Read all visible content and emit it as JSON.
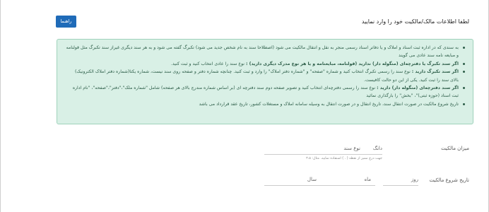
{
  "header": {
    "title": "لطفا اطلاعات مالک/مالکیت خود را وارد نمایید",
    "guide_button": "راهنما"
  },
  "info": {
    "item1": "به سندی که در اداره ثبت اسناد و املاک و یا دفاتر اسناد رسمی منجر به نقل و انتقال مالکیت می شود (اصطلاحا سند به نام شخص جدید می شود) تکبرگ گفته می شود و به هر سند دیگری غیراز سند تکبرگ مثل قولنامه و مبایعه نامه سند عادی می گویند",
    "item2_bold": "اگر سند تکبرگ یا دفترچه‌ای (منگوله دار) ندارید (قولنامه، مبایعنامه و یا هر نوع مدرک دیگری دارید) :",
    "item2_rest": "نوع سند را عادی انتخاب کنید و ثبت کنید.",
    "item3_bold": "اگر سند تکبرگ دارید :",
    "item3_rest": "نوع سند را رسمی تکبرگ انتخاب کنید و شماره \"صفحه\" و \"شماره دفتر املاک\" را وارد و ثبت کنید. چنانچه شماره دفتر و صفحه روی سند نیست، شماره یکتا(شماره دفتر املاک الکترونیک) بالای سند را ثبت کنید. یکی از این دو حالت کافیست.",
    "item4_bold": "اگر سند دفترچه‌ای (منگوله دار) دارید :",
    "item4_rest": "نوع سند را رسمی دفترچه‌ای انتخاب کنید و تصویر صفحه دوم سند دفترچه ای (بر اساس شماره مندرج بالای هر صفحه) شامل \"شماره ملک\"،\"دفتر\"،\"صفحه\"، \"نام اداره ثبت اسناد (حوزه ثبتی)\"، \"بخش\" را بارگذاری نمائید",
    "item5": "تاریخ شروع مالکیت در صورت انتقال سند، تاریخ انتقال و در صورت انتقال به وسیله سامانه املاک و مستغلات کشور، تاریخ عقد قرارداد می باشد"
  },
  "ownership": {
    "amount_label": "میزان مالکیت",
    "dang_suffix": "دانگ",
    "doc_type_placeholder": "نوع سند",
    "hint": "جهت درج ممیز از نقطه ( . ) استفاده نمایید. مثال: ۳.۵"
  },
  "start_date": {
    "label": "تاریخ شروع مالکیت",
    "day": "روز",
    "month": "ماه",
    "year": "سال"
  }
}
